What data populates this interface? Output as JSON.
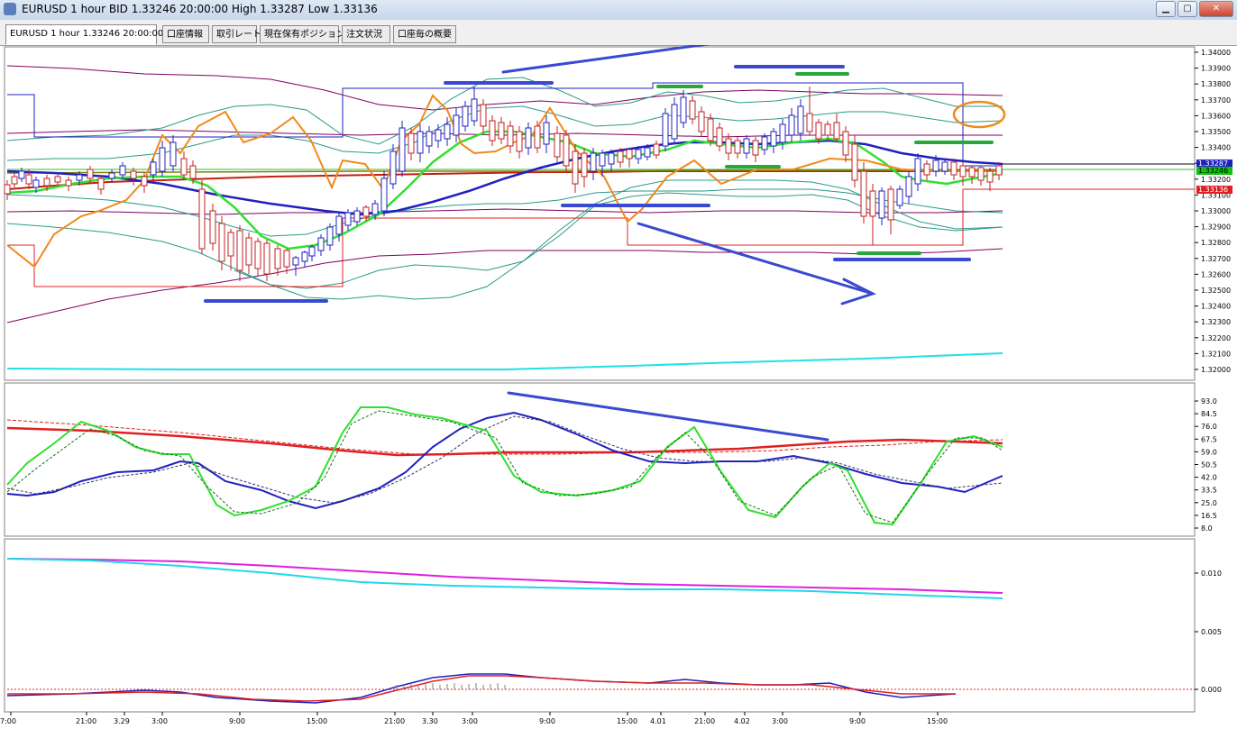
{
  "window": {
    "title": "EURUSD 1 hour BID 1.33246 20:00:00 High 1.33287 Low 1.33136"
  },
  "window_controls": [
    "▁",
    "▢",
    "✕"
  ],
  "tabs": [
    {
      "label": "EURUSD 1 hour 1.33246 20:00:00",
      "active": true
    },
    {
      "label": "口座情報"
    },
    {
      "label": "取引レート"
    },
    {
      "label": "現在保有ポジション"
    },
    {
      "label": "注文状況"
    },
    {
      "label": "口座毎の概要"
    }
  ],
  "price_axis": {
    "labels": [
      "1.34000",
      "1.33900",
      "1.33800",
      "1.33700",
      "1.33600",
      "1.33500",
      "1.33400",
      "1.33300",
      "1.33200",
      "1.33100",
      "1.33000",
      "1.32900",
      "1.32800",
      "1.32700",
      "1.32600",
      "1.32500",
      "1.32400",
      "1.32300",
      "1.32200",
      "1.32100",
      "1.32000"
    ],
    "badges": {
      "top": "1.33287",
      "current": "1.33246",
      "low": "1.33136"
    }
  },
  "osc_axis": {
    "labels": [
      "93.0",
      "84.5",
      "76.0",
      "67.5",
      "59.0",
      "50.5",
      "42.0",
      "33.5",
      "25.0",
      "16.5",
      "8.0"
    ]
  },
  "ind_axis": {
    "labels": [
      "0.010",
      "0.005",
      "0.000"
    ]
  },
  "time_axis": {
    "labels": [
      "7:00",
      "21:00",
      "3.29",
      "3:00",
      "9:00",
      "15:00",
      "21:00",
      "3.30",
      "3:00",
      "9:00",
      "15:00",
      "4.01",
      "21:00",
      "4.02",
      "3:00",
      "9:00",
      "15:00"
    ]
  },
  "colors": {
    "blue": "#2020c0",
    "green": "#30e030",
    "red": "#e02020",
    "orange": "#f08a1c",
    "teal": "#2a9a8a",
    "purple": "#800060",
    "cyan": "#20e0e8",
    "magenta": "#e020e0",
    "annot_blue": "#3a4ad0",
    "annot_green": "#28a838"
  }
}
